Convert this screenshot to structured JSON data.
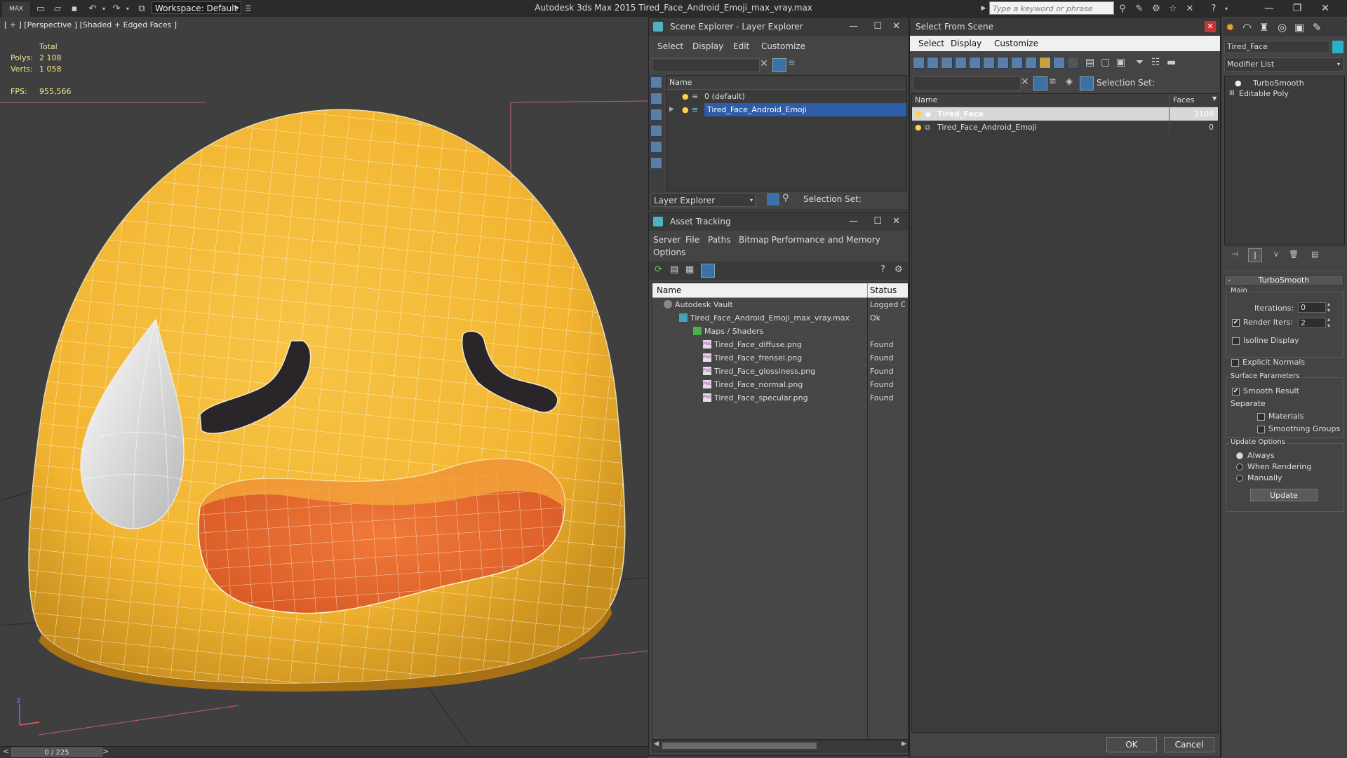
{
  "titlebar": {
    "logo": "MAX",
    "workspace_label": "Workspace: Default",
    "app_title": "Autodesk 3ds Max  2015    Tired_Face_Android_Emoji_max_vray.max",
    "search_placeholder": "Type a keyword or phrase"
  },
  "viewport": {
    "label": "[ + ] [Perspective ] [Shaded + Edged Faces ]",
    "stats_header": "Total",
    "polys_label": "Polys:",
    "polys_value": "2 108",
    "verts_label": "Verts:",
    "verts_value": "1 058",
    "fps_label": "FPS:",
    "fps_value": "955,566",
    "axis_label": "z"
  },
  "timeline": {
    "frame": "0 / 225",
    "prev": "<",
    "next": ">"
  },
  "scene_explorer": {
    "title": "Scene Explorer - Layer Explorer",
    "menus": [
      "Select",
      "Display",
      "Edit",
      "Customize"
    ],
    "column_name": "Name",
    "rows": [
      {
        "label": "0 (default)",
        "selected": false
      },
      {
        "label": "Tired_Face_Android_Emoji",
        "selected": true
      }
    ],
    "footer_dropdown": "Layer Explorer",
    "selection_set_label": "Selection Set:"
  },
  "asset_tracking": {
    "title": "Asset Tracking",
    "menus": [
      "Server",
      "File",
      "Paths",
      "Bitmap Performance and Memory"
    ],
    "menu_options": "Options",
    "columns": [
      "Name",
      "Status"
    ],
    "rows": [
      {
        "name": "Autodesk Vault",
        "status": "Logged Out"
      },
      {
        "name": "Tired_Face_Android_Emoji_max_vray.max",
        "status": "Ok"
      },
      {
        "name": "Maps / Shaders",
        "status": ""
      },
      {
        "name": "Tired_Face_diffuse.png",
        "status": "Found"
      },
      {
        "name": "Tired_Face_frensel.png",
        "status": "Found"
      },
      {
        "name": "Tired_Face_glossiness.png",
        "status": "Found"
      },
      {
        "name": "Tired_Face_normal.png",
        "status": "Found"
      },
      {
        "name": "Tired_Face_specular.png",
        "status": "Found"
      }
    ],
    "png_badge": "PNG"
  },
  "select_from_scene": {
    "title": "Select From Scene",
    "menus": [
      "Select",
      "Display",
      "Customize"
    ],
    "selection_set_label": "Selection Set:",
    "columns": [
      "Name",
      "Faces"
    ],
    "rows": [
      {
        "name": "Tired_Face",
        "faces": "2108"
      },
      {
        "name": "Tired_Face_Android_Emoji",
        "faces": "0"
      }
    ],
    "ok": "OK",
    "cancel": "Cancel"
  },
  "command_panel": {
    "object_name": "Tired_Face",
    "modifier_list": "Modifier List",
    "stack": [
      "TurboSmooth",
      "Editable Poly"
    ],
    "rollout_title": "TurboSmooth",
    "main_group": "Main",
    "iterations_label": "Iterations:",
    "iterations_value": "0",
    "render_iters_label": "Render Iters:",
    "render_iters_value": "2",
    "isoline_display": "Isoline Display",
    "explicit_normals": "Explicit Normals",
    "surface_group": "Surface Parameters",
    "smooth_result": "Smooth Result",
    "separate_label": "Separate",
    "materials": "Materials",
    "smoothing_groups": "Smoothing Groups",
    "update_group": "Update Options",
    "always": "Always",
    "when_rendering": "When Rendering",
    "manually": "Manually",
    "update_button": "Update"
  }
}
